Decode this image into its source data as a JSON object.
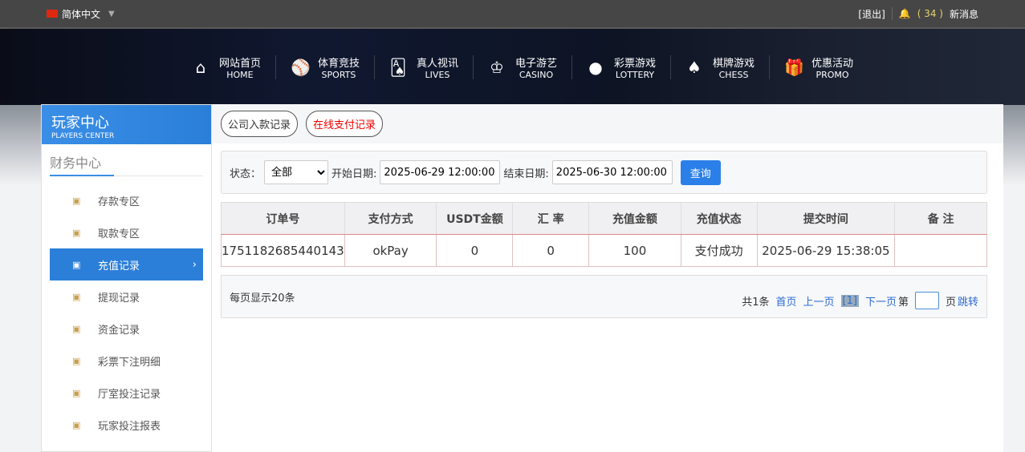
{
  "topbar": {
    "language": "简体中文",
    "logout": "[退出]",
    "message_count": "( 34 )",
    "messages": "新消息"
  },
  "nav": [
    {
      "cn": "网站首页",
      "en": "HOME",
      "icon": "⌂"
    },
    {
      "cn": "体育竞技",
      "en": "SPORTS",
      "icon": "⚾"
    },
    {
      "cn": "真人视讯",
      "en": "LIVES",
      "icon": "🂡"
    },
    {
      "cn": "电子游艺",
      "en": "CASINO",
      "icon": "♔"
    },
    {
      "cn": "彩票游戏",
      "en": "LOTTERY",
      "icon": "●"
    },
    {
      "cn": "棋牌游戏",
      "en": "CHESS",
      "icon": "♠"
    },
    {
      "cn": "优惠活动",
      "en": "PROMO",
      "icon": "🎁"
    }
  ],
  "sidebar": {
    "title_cn": "玩家中心",
    "title_en": "PLAYERS CENTER",
    "section": "财务中心",
    "items": [
      {
        "label": "存款专区"
      },
      {
        "label": "取款专区"
      },
      {
        "label": "充值记录"
      },
      {
        "label": "提现记录"
      },
      {
        "label": "资金记录"
      },
      {
        "label": "彩票下注明细"
      },
      {
        "label": "厅室投注记录"
      },
      {
        "label": "玩家投注报表"
      }
    ]
  },
  "tabs": {
    "company": "公司入款记录",
    "online": "在线支付记录"
  },
  "filter": {
    "status_label": "状态：",
    "status_value": "全部",
    "start_label": "开始日期:",
    "start_value": "2025-06-29 12:00:00",
    "end_label": "结束日期:",
    "end_value": "2025-06-30 12:00:00",
    "query": "查询"
  },
  "table": {
    "headers": [
      "订单号",
      "支付方式",
      "USDT金额",
      "汇 率",
      "充值金额",
      "充值状态",
      "提交时间",
      "备 注"
    ],
    "rows": [
      [
        "1751182685440143",
        "okPay",
        "0",
        "0",
        "100",
        "支付成功",
        "2025-06-29 15:38:05",
        ""
      ]
    ]
  },
  "pager": {
    "per_page": "每页显示20条",
    "total": "共1条",
    "first": "首页",
    "prev": "上一页",
    "current": "[1]",
    "next": "下一页",
    "page_prefix": "第",
    "page_suffix": "页",
    "go": "跳转"
  }
}
